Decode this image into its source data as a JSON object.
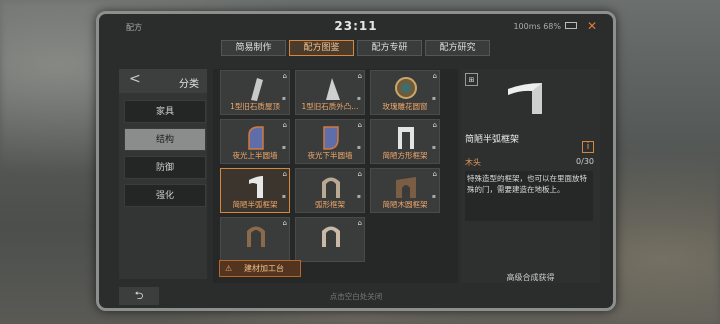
{
  "status": {
    "app": "配方",
    "time": "23:11",
    "network": "100ms 68%"
  },
  "tabs": [
    {
      "label": "简易制作",
      "active": false
    },
    {
      "label": "配方图鉴",
      "active": true
    },
    {
      "label": "配方专研",
      "active": false
    },
    {
      "label": "配方研究",
      "active": false
    }
  ],
  "sidebar": {
    "title": "分类",
    "items": [
      {
        "label": "家具",
        "active": false
      },
      {
        "label": "结构",
        "active": true
      },
      {
        "label": "防御",
        "active": false
      },
      {
        "label": "强化",
        "active": false
      }
    ]
  },
  "recipes": [
    {
      "label": "1型旧石质屋顶",
      "icon": "roof-icon",
      "locked": true
    },
    {
      "label": "1型旧石质外凸...",
      "icon": "triangle-wall-icon",
      "locked": true
    },
    {
      "label": "玫瑰雕花圆窗",
      "icon": "round-window-icon",
      "locked": true
    },
    {
      "label": "夜光上半圆墙",
      "icon": "glow-arc-wall-icon",
      "locked": true
    },
    {
      "label": "夜光下半圆墙",
      "icon": "glow-arc-wall-icon",
      "locked": true
    },
    {
      "label": "简陋方形框架",
      "icon": "square-frame-icon",
      "locked": true
    },
    {
      "label": "简陋半弧框架",
      "icon": "half-arc-frame-icon",
      "locked": true,
      "selected": true
    },
    {
      "label": "弧形框架",
      "icon": "arch-frame-icon",
      "locked": true
    },
    {
      "label": "简陋木圆框架",
      "icon": "wood-round-frame-icon",
      "locked": true
    },
    {
      "label": "",
      "icon": "arch-frame-icon",
      "locked": true
    },
    {
      "label": "",
      "icon": "arch-frame-icon",
      "locked": true
    }
  ],
  "workbench": {
    "label": "建材加工台"
  },
  "detail": {
    "name": "简陋半弧框架",
    "material": "木头",
    "count": "0/30",
    "description": "特殊造型的框架，也可以在里面放特殊的门，需要建造在地板上。",
    "obtain": "高级合成获得"
  },
  "hint": "点击空白处关闭",
  "colors": {
    "accent": "#d7863f",
    "panel": "#2b2c2c"
  }
}
